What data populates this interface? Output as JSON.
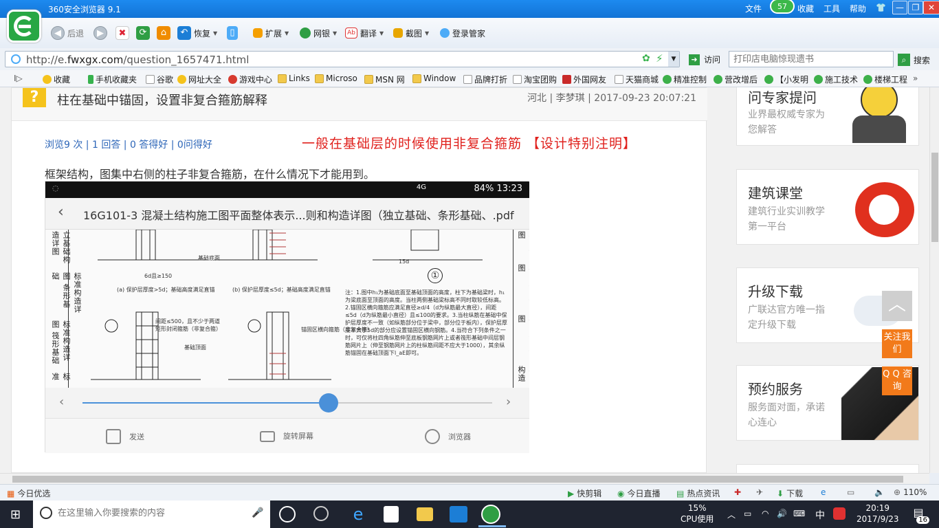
{
  "window": {
    "title": "360安全浏览器 9.1",
    "menu": [
      "文件",
      "收藏",
      "工具",
      "帮助"
    ],
    "badge": "57"
  },
  "toolbar": {
    "back": "后退",
    "restore": "恢复",
    "extend": "扩展",
    "bank": "网银",
    "translate": "翻译",
    "screenshot": "截图",
    "login": "登录管家"
  },
  "address": {
    "url_prefix": "http://e.",
    "url_domain": "fwxgx.com",
    "url_path": "/question_1657471.html",
    "visit": "访问",
    "search_placeholder": "打印店电脑惊现遗书",
    "search_button": "搜索"
  },
  "bookmarks": [
    "收藏",
    "手机收藏夹",
    "谷歌",
    "网址大全",
    "游戏中心",
    "Links",
    "Microso",
    "MSN 网",
    "Window",
    "品牌打折",
    "淘宝团购",
    "外国网友",
    "天猫商城",
    "精准控制",
    "营改增后",
    "【小发明",
    "施工技术",
    "楼梯工程"
  ],
  "question": {
    "icon": "?",
    "title": "柱在基础中锚固，设置非复合箍筋解释",
    "meta": "河北 | 李梦琪 | 2017-09-23 20:07:21",
    "stats": "浏览9 次 | 1 回答 | 0 答得好 | 0问得好",
    "red_note": "一般在基础层的时候使用非复合箍筋 【设计特别注明】",
    "body": "框架结构，图集中右侧的柱子非复合箍筋，在什么情况下才能用到。"
  },
  "phone": {
    "status": "84% 13:23",
    "status_network": "4G",
    "title": "16G101-3 混凝土结构施工图平面整体表示...则和构造详图（独立基础、条形基础、.pdf",
    "left_labels": [
      "立基础构造详图",
      "标准构造详图 条形基础",
      "标准构造详图 筏形基础",
      "标准"
    ],
    "right_labels": [
      "构造详图",
      "标准构造详图",
      "标准构造详图",
      "标准构造"
    ],
    "captions": [
      "(a) 保护层厚度>5d；基础高度满足直锚",
      "(b) 保护层厚度≤5d；基础高度满足直锚",
      "基础底面",
      "基础顶面",
      "锚固区横向箍筋（非复合箍）",
      "间距≤500，且不少于两道矩形封闭箍筋（非复合箍）",
      "6d且≥150",
      "15d",
      "①"
    ],
    "note": "注：1.图中h₁为基础底面至基础顶面的高度，柱下为基础梁时，h₁为梁底面至顶面的高度。当柱两侧基础梁标高不同时取较低标高。2.锚固区横向箍筋应满足直径≥d/4（d为纵筋最大直径），间距≤5d（d为纵筋最小直径）且≤100的要求。3.当柱纵筋在基础中保护层厚度不一致（如纵筋部分位于梁中，部分位于板内），保护层厚度不大于5d的部分应设置锚固区横向钢筋。4.当符合下列条件之一时，可仅将柱四角纵筋伸至底板钢筋网片上或者筏形基础中间层钢筋网片上（伸至钢筋网片上的柱纵筋间距不应大于1000），其余纵筋锚固在基础顶面下l_aE即可。",
    "slider_fraction": 0.6,
    "actions": [
      "发送",
      "旋转屏幕",
      "浏览器"
    ]
  },
  "sidebar": [
    {
      "title": "问专家提问",
      "desc": "业界最权威专家为您解答"
    },
    {
      "title": "建筑课堂",
      "desc": "建筑行业实训教学第一平台"
    },
    {
      "title": "升级下载",
      "desc": "广联达官方唯一指定升级下载"
    },
    {
      "title": "预约服务",
      "desc": "服务面对面，承诺心连心"
    }
  ],
  "float": {
    "follow": "关注我们",
    "qq": "Q Q 咨询"
  },
  "statusbar": {
    "left": "今日优选",
    "items": [
      "快剪辑",
      "今日直播",
      "热点资讯",
      "下载"
    ],
    "zoom": "110%"
  },
  "taskbar": {
    "search_placeholder": "在这里输入你要搜索的内容",
    "cpu_value": "15%",
    "cpu_label": "CPU使用",
    "ime": "中",
    "time": "20:19",
    "date": "2017/9/23",
    "notifications": "16"
  },
  "colors": {
    "accent": "#1273d6",
    "red_note": "#e0211d",
    "link": "#2d66b8",
    "float": "#f27a1a"
  }
}
